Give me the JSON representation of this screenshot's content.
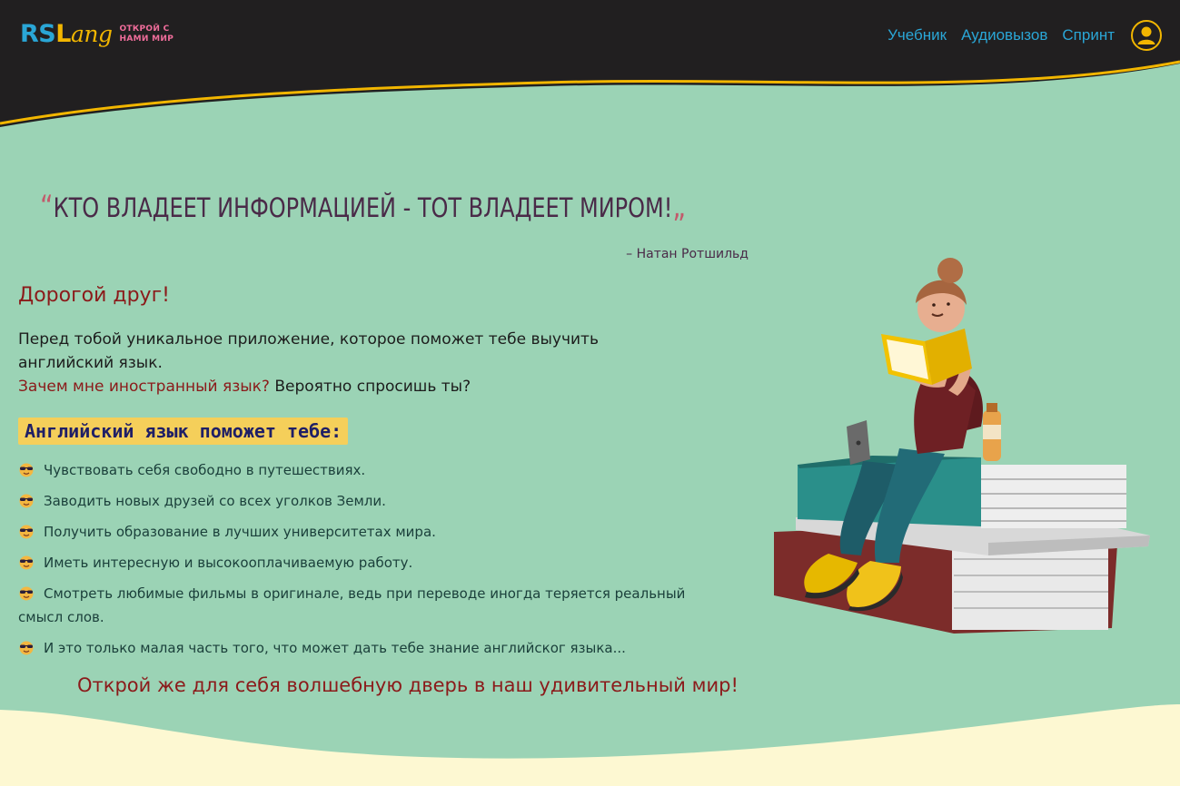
{
  "brand": {
    "logo_part1": "RS",
    "logo_part2": "L",
    "logo_part3": "ang",
    "tagline_line1": "ОТКРОЙ С",
    "tagline_line2": "НАМИ МИР"
  },
  "nav": {
    "items": [
      {
        "label": "Учебник"
      },
      {
        "label": "Аудиовызов"
      },
      {
        "label": "Спринт"
      }
    ],
    "user_icon": "user-icon"
  },
  "quote": {
    "open_mark": "“",
    "text": "КТО ВЛАДЕЕТ ИНФОРМАЦИЕЙ - ТОТ ВЛАДЕЕТ МИРОМ!",
    "close_mark": "„",
    "author": "– Натан Ротшильд"
  },
  "intro": {
    "greeting": "Дорогой друг!",
    "line1": "Перед тобой уникальное приложение, которое поможет тебе выучить английский язык.",
    "question": "Зачем мне иностранный язык?",
    "question_tail": " Вероятно спросишь ты?"
  },
  "benefits": {
    "heading": "Английский язык поможет тебе:",
    "emoji_icon": "sunglasses-face-icon",
    "items": [
      "Чувствовать себя свободно в путешествиях.",
      "Заводить новых друзей со всех уголков Земли.",
      "Получить образование в лучших университетах мира.",
      "Иметь интересную и высокооплачиваемую работу.",
      "Смотреть любимые фильмы в оригинале, ведь при переводе иногда теряется реальный смысл слов.",
      "И это только малая часть того, что может дать тебе знание английског языка..."
    ]
  },
  "cta": "Открой же для себя волшебную дверь в наш удивительный мир!",
  "colors": {
    "header_bg": "#211f20",
    "accent_blue": "#2aa6d6",
    "accent_yellow": "#f2b600",
    "page_bg": "#9bd3b5",
    "footer_wave": "#fdf8d2"
  }
}
